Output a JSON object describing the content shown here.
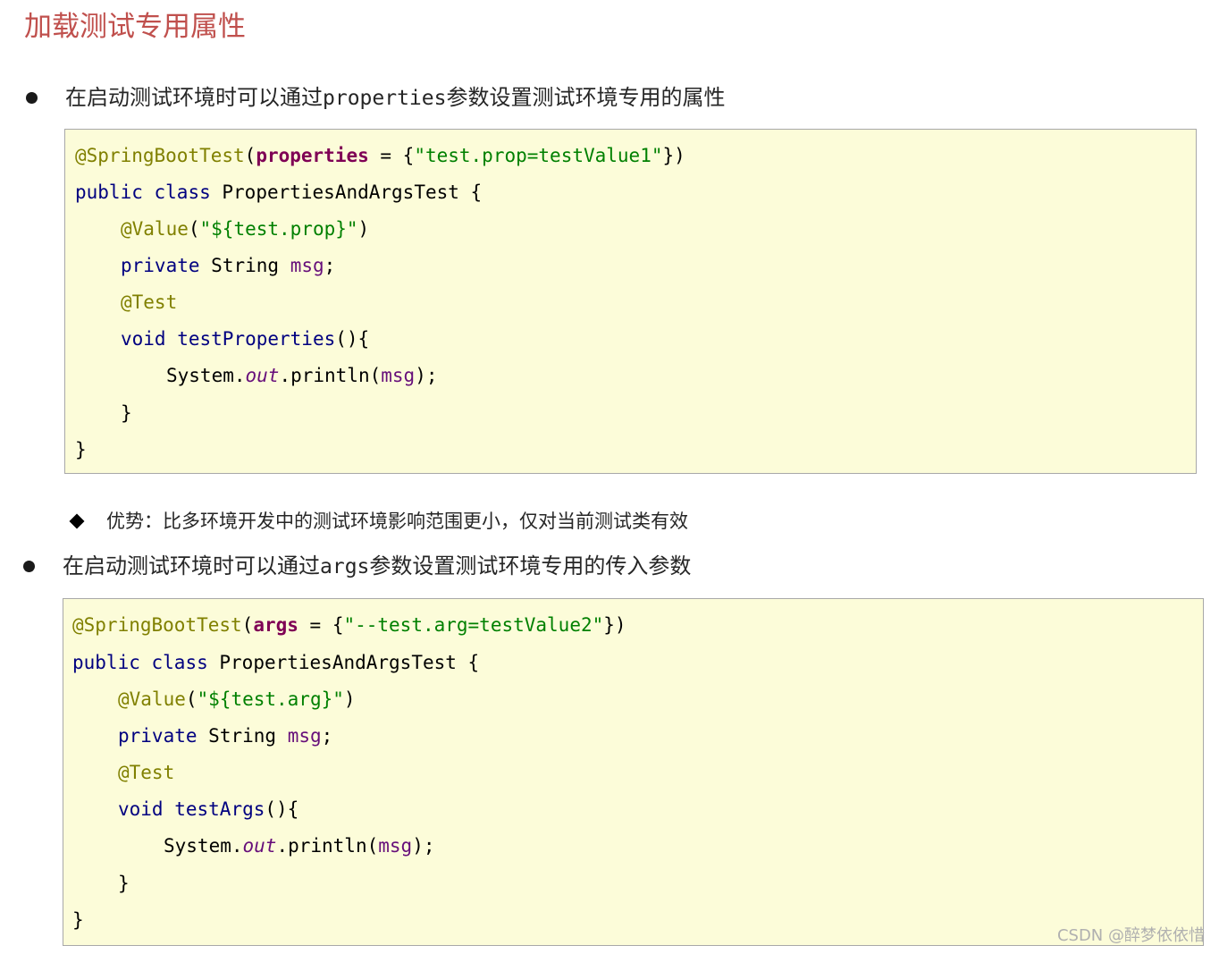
{
  "title": "加载测试专用属性",
  "bullet1": {
    "prefix": "在启动测试环境时可以通过",
    "code": "properties",
    "suffix": "参数设置测试环境专用的属性"
  },
  "code1": {
    "l1": {
      "ann": "@SpringBootTest",
      "open": "(",
      "attr": "properties",
      "eq": " = {",
      "str": "\"test.prop=testValue1\"",
      "close": "})"
    },
    "l2": {
      "kw1": "public",
      "kw2": "class",
      "name": "PropertiesAndArgsTest {"
    },
    "l3": {
      "ann": "@Value",
      "open": "(",
      "str": "\"${test.prop}\"",
      "close": ")"
    },
    "l4": {
      "kw": "private",
      "type": "String",
      "field": "msg",
      "end": ";"
    },
    "l5": {
      "ann": "@Test"
    },
    "l6": {
      "kw": "void",
      "method": "testProperties",
      "end": "(){"
    },
    "l7": {
      "cls": "System.",
      "stat": "out",
      "call": ".println(",
      "field": "msg",
      "end": ");"
    },
    "l8": "}",
    "l9": "}"
  },
  "sub1": "优势：比多环境开发中的测试环境影响范围更小，仅对当前测试类有效",
  "bullet2": {
    "prefix": "在启动测试环境时可以通过",
    "code": "args",
    "suffix": "参数设置测试环境专用的传入参数"
  },
  "code2": {
    "l1": {
      "ann": "@SpringBootTest",
      "open": "(",
      "attr": "args",
      "eq": " = {",
      "str": "\"--test.arg=testValue2\"",
      "close": "})"
    },
    "l2": {
      "kw1": "public",
      "kw2": "class",
      "name": "PropertiesAndArgsTest {"
    },
    "l3": {
      "ann": "@Value",
      "open": "(",
      "str": "\"${test.arg}\"",
      "close": ")"
    },
    "l4": {
      "kw": "private",
      "type": "String",
      "field": "msg",
      "end": ";"
    },
    "l5": {
      "ann": "@Test"
    },
    "l6": {
      "kw": "void",
      "method": "testArgs",
      "end": "(){"
    },
    "l7": {
      "cls": "System.",
      "stat": "out",
      "call": ".println(",
      "field": "msg",
      "end": ");"
    },
    "l8": "}",
    "l9": "}"
  },
  "watermark": "CSDN @醉梦依依惜"
}
